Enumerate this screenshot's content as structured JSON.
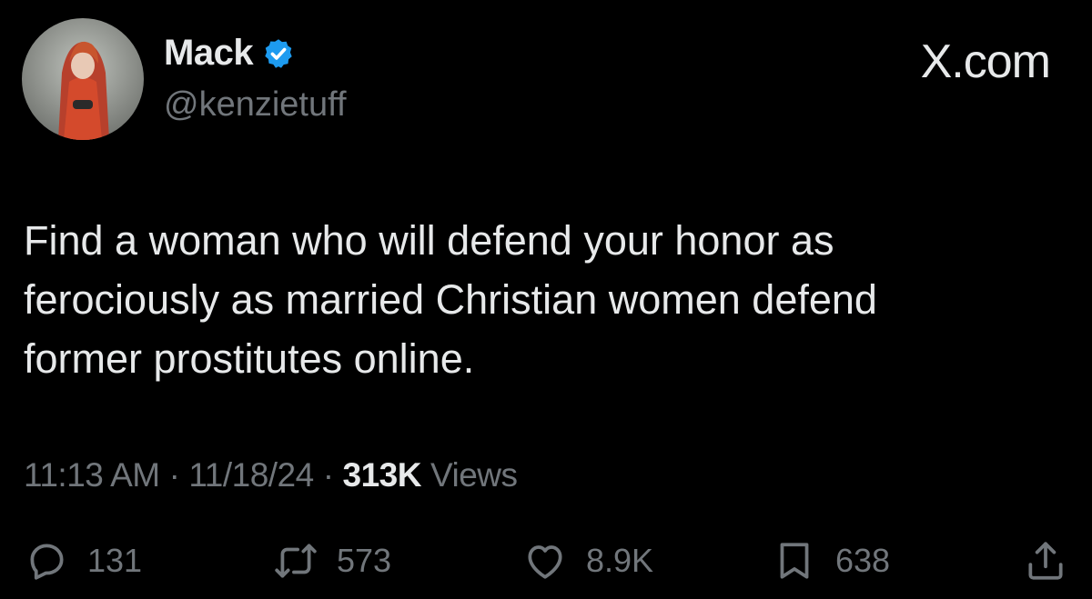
{
  "brand": {
    "label": "X.com"
  },
  "author": {
    "display_name": "Mack",
    "handle": "@kenzietuff",
    "verified": true,
    "verified_color": "#1d9bf0"
  },
  "tweet": {
    "text_lines": [
      "Find a woman who will defend your honor as",
      "ferociously as married Christian women defend",
      "former prostitutes online."
    ],
    "time": "11:13 AM",
    "date": "11/18/24",
    "separator": "·",
    "views_count": "313K",
    "views_label": "Views"
  },
  "actions": {
    "replies": {
      "icon": "reply-icon",
      "count": "131"
    },
    "reposts": {
      "icon": "repost-icon",
      "count": "573"
    },
    "likes": {
      "icon": "heart-icon",
      "count": "8.9K"
    },
    "bookmarks": {
      "icon": "bookmark-icon",
      "count": "638"
    },
    "share": {
      "icon": "share-icon"
    }
  },
  "colors": {
    "background": "#000000",
    "text": "#e7e9ea",
    "muted": "#71767b",
    "accent": "#1d9bf0"
  }
}
